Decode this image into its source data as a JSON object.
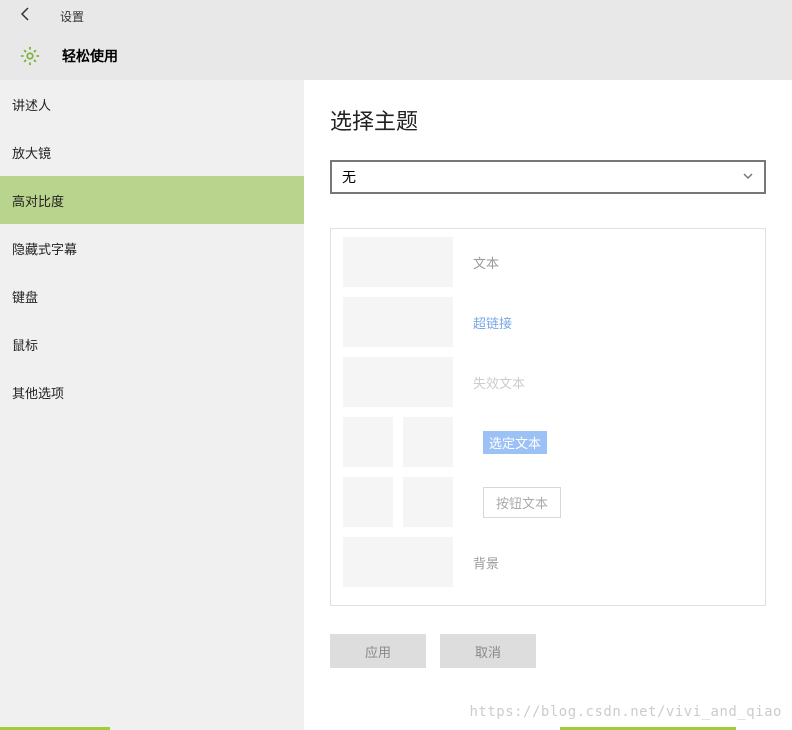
{
  "header": {
    "title": "设置"
  },
  "subheader": {
    "title": "轻松使用"
  },
  "sidebar": {
    "items": [
      {
        "label": "讲述人"
      },
      {
        "label": "放大镜"
      },
      {
        "label": "高对比度"
      },
      {
        "label": "隐藏式字幕"
      },
      {
        "label": "键盘"
      },
      {
        "label": "鼠标"
      },
      {
        "label": "其他选项"
      }
    ]
  },
  "content": {
    "title": "选择主题",
    "theme_select_value": "无",
    "preview": {
      "text_label": "文本",
      "hyperlink_label": "超链接",
      "disabled_label": "失效文本",
      "selected_label": "选定文本",
      "button_label": "按钮文本",
      "background_label": "背景"
    },
    "buttons": {
      "apply": "应用",
      "cancel": "取消"
    }
  },
  "watermark": "https://blog.csdn.net/vivi_and_qiao"
}
